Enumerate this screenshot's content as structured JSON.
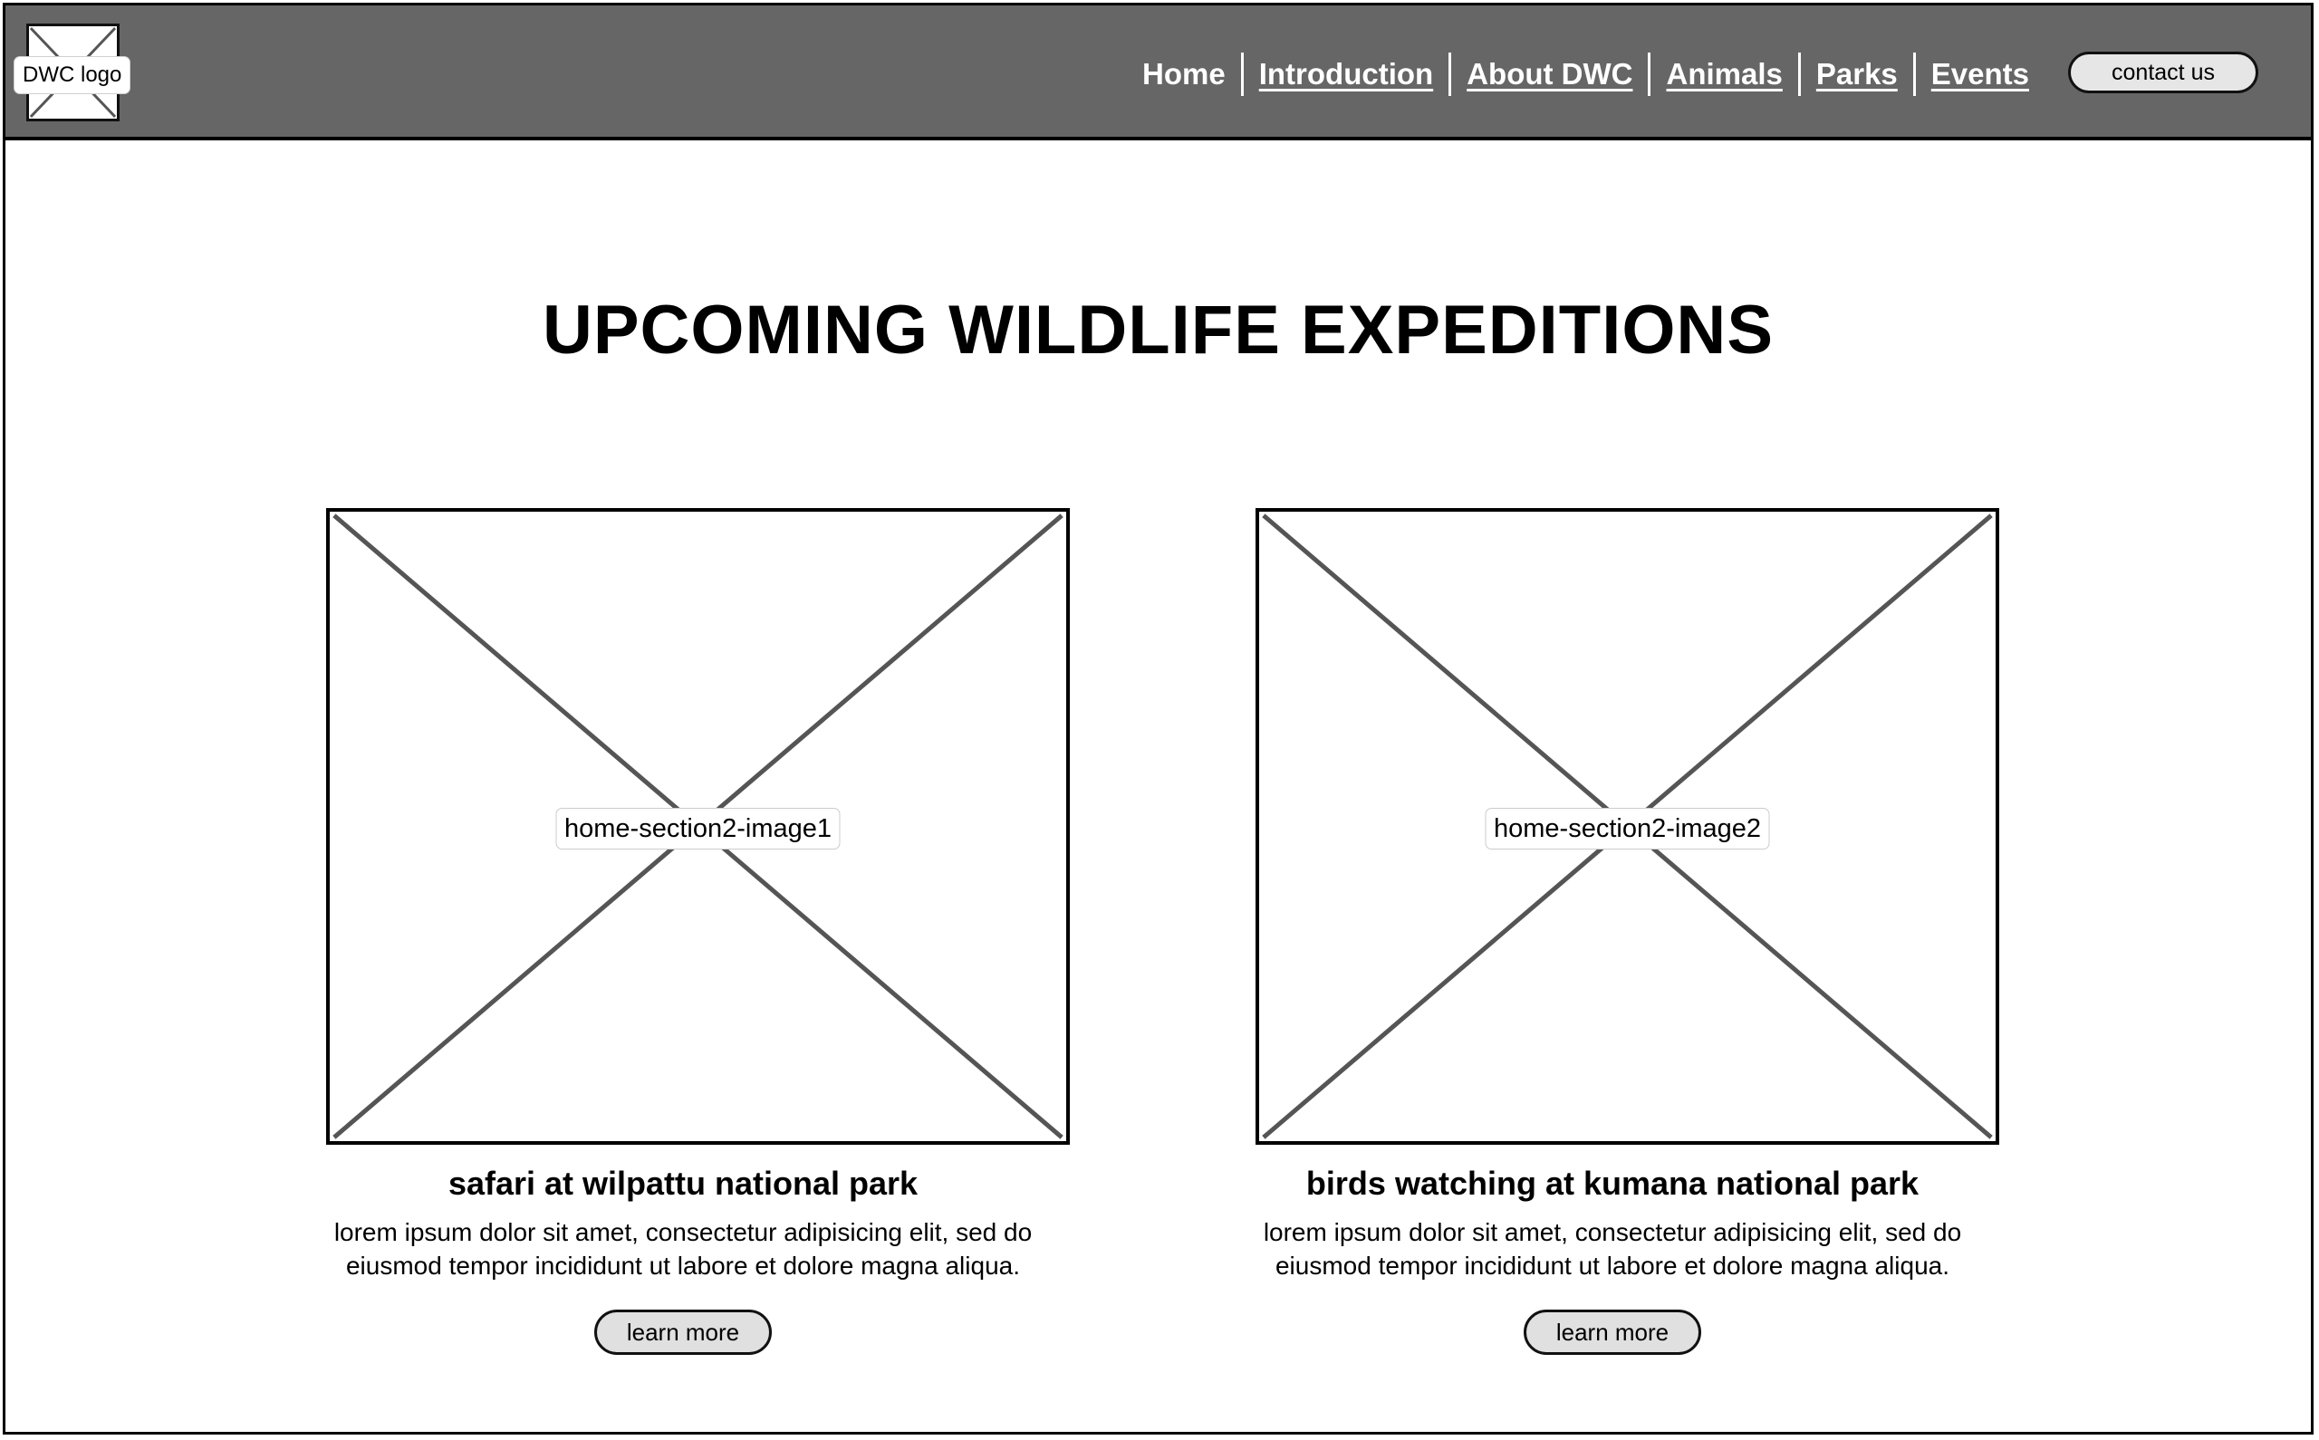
{
  "header": {
    "logo_label": "DWC logo",
    "nav": [
      {
        "label": "Home"
      },
      {
        "label": "Introduction"
      },
      {
        "label": "About DWC"
      },
      {
        "label": "Animals"
      },
      {
        "label": "Parks"
      },
      {
        "label": "Events"
      }
    ],
    "contact_label": "contact us"
  },
  "main": {
    "title": "UPCOMING WILDLIFE EXPEDITIONS",
    "cards": [
      {
        "image_label": "home-section2-image1",
        "title": "safari at wilpattu national park",
        "text": "lorem ipsum dolor sit amet, consectetur adipisicing elit, sed do eiusmod tempor incididunt ut labore et dolore magna aliqua.",
        "button_label": "learn more"
      },
      {
        "image_label": "home-section2-image2",
        "title": "birds watching at kumana national park",
        "text": "lorem ipsum dolor sit amet, consectetur adipisicing elit, sed do eiusmod tempor incididunt ut labore et dolore magna aliqua.",
        "button_label": "learn more"
      }
    ]
  },
  "colors": {
    "header_bg": "#666666",
    "button_bg": "#e0e0e0",
    "placeholder_cross": "#555555"
  }
}
